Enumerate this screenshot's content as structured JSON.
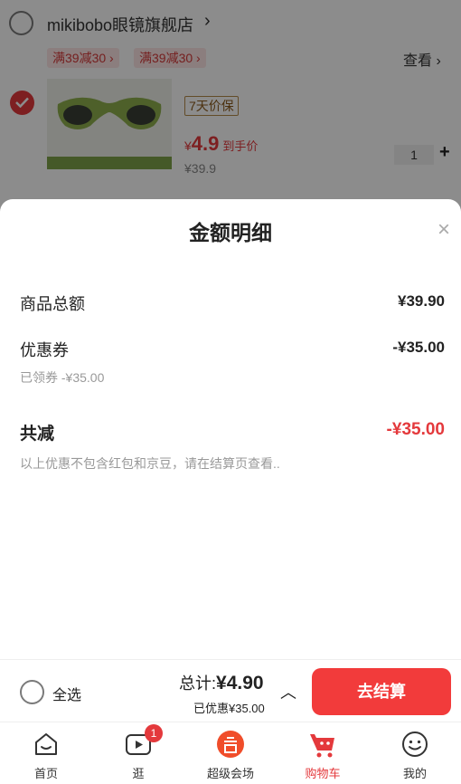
{
  "store": {
    "name": "mikibobo眼镜旗舰店",
    "promos": [
      "满39减30",
      "满39减30"
    ],
    "view_label": "查看"
  },
  "product": {
    "tag": "7天价保",
    "price_symbol": "¥",
    "price_value": "4.9",
    "price_suffix": "到手价",
    "original_price": "¥39.9",
    "quantity": "1"
  },
  "sheet": {
    "title": "金额明细",
    "rows": [
      {
        "label": "商品总额",
        "value": "¥39.90"
      },
      {
        "label": "优惠券",
        "value": "-¥35.00"
      }
    ],
    "coupon_sub": "已领券 -¥35.00",
    "total_label": "共减",
    "total_value": "-¥35.00",
    "note": "以上优惠不包含红包和京豆，请在结算页查看.."
  },
  "bottom_bar": {
    "select_all": "全选",
    "total_prefix": "总计:",
    "total_amount": "¥4.90",
    "discount": "已优惠¥35.00",
    "checkout": "去结算"
  },
  "tabs": [
    {
      "label": "首页",
      "icon": "home-icon"
    },
    {
      "label": "逛",
      "icon": "video-icon",
      "badge": "1"
    },
    {
      "label": "超级会场",
      "icon": "venue-icon"
    },
    {
      "label": "购物车",
      "icon": "cart-icon"
    },
    {
      "label": "我的",
      "icon": "profile-icon"
    }
  ],
  "colors": {
    "accent": "#e4393c",
    "checkout": "#f23b3b"
  }
}
